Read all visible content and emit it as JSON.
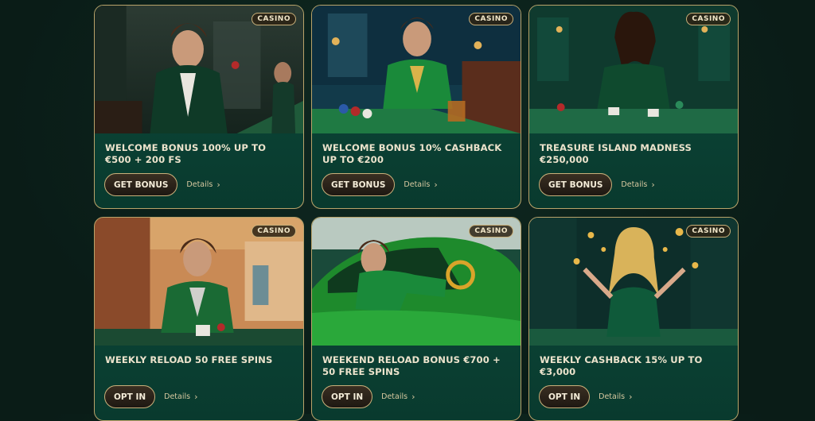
{
  "cards": [
    {
      "badge": "CASINO",
      "title": "WELCOME BONUS 100% UP TO €500 + 200 FS",
      "button": "GET BONUS",
      "details": "Details",
      "art_icon": "man-in-green-tuxedo-holding-chip"
    },
    {
      "badge": "CASINO",
      "title": "WELCOME BONUS 10% CASHBACK UP TO €200",
      "button": "GET BONUS",
      "details": "Details",
      "art_icon": "man-at-roulette-table"
    },
    {
      "badge": "CASINO",
      "title": "TREASURE ISLAND MADNESS €250,000",
      "button": "GET BONUS",
      "details": "Details",
      "art_icon": "woman-dealing-cards"
    },
    {
      "badge": "CASINO",
      "title": "WEEKLY RELOAD 50 FREE SPINS",
      "button": "OPT IN",
      "details": "Details",
      "art_icon": "man-playing-cards"
    },
    {
      "badge": "CASINO",
      "title": "WEEKEND RELOAD BONUS €700 + 50 FREE SPINS",
      "button": "OPT IN",
      "details": "Details",
      "art_icon": "man-in-green-sports-car"
    },
    {
      "badge": "CASINO",
      "title": "WEEKLY CASHBACK 15% UP TO €3,000",
      "button": "OPT IN",
      "details": "Details",
      "art_icon": "woman-with-gold-coins"
    }
  ],
  "colors": {
    "background": "#0a1c17",
    "card": "#0d4a3b",
    "border_gold": "#b9a36a",
    "text": "#ece3cc"
  }
}
